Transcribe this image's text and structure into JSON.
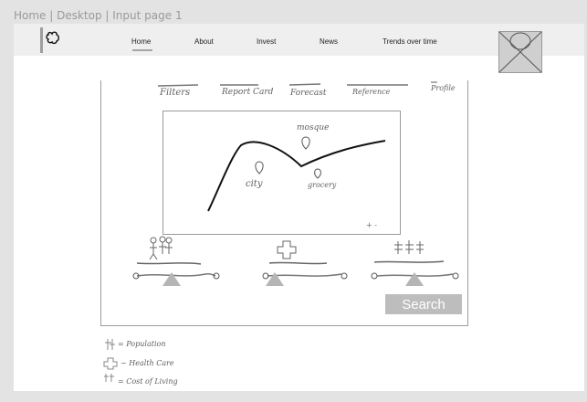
{
  "breadcrumb": "Home | Desktop | Input page 1",
  "nav": {
    "items": [
      {
        "label": "Home"
      },
      {
        "label": "About"
      },
      {
        "label": "Invest"
      },
      {
        "label": "News"
      },
      {
        "label": "Trends over time"
      }
    ]
  },
  "sketch": {
    "filters": [
      "Filters",
      "Report Card",
      "Forecast",
      "Reference",
      "Profile"
    ],
    "map_labels": {
      "mosque": "mosque",
      "city": "city",
      "grocery": "grocery",
      "zoom": "+ -"
    },
    "search_label": "Search",
    "legend": [
      "= Population",
      "~ Health Care",
      "= Cost of Living"
    ]
  }
}
